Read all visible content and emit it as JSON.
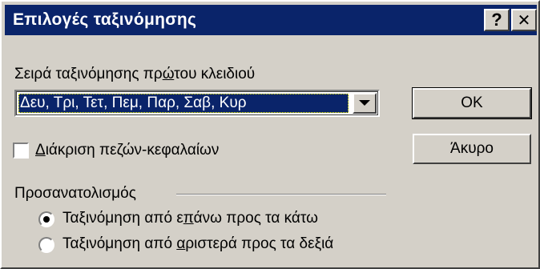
{
  "window": {
    "title": "Επιλογές ταξινόμησης",
    "help_label": "?",
    "close_label": "✕"
  },
  "first_key": {
    "label_before": "Σειρά ταξινόμησης πρ",
    "label_hotkey": "ώ",
    "label_after": "του κλειδιού",
    "selected_value": "Δευ, Τρι, Τετ, Πεμ, Παρ, Σαβ, Κυρ"
  },
  "case_sensitive": {
    "label_hotkey": "Δ",
    "label_after": "ιάκριση πεζών-κεφαλαίων",
    "checked": false
  },
  "orientation": {
    "label": "Προσανατολισμός",
    "options": [
      {
        "before": "Ταξινόμηση από ε",
        "hotkey": "π",
        "after": "άνω προς τα κάτω",
        "selected": true
      },
      {
        "before": "Ταξινόμηση από ",
        "hotkey": "α",
        "after": "ριστερά προς τα δεξιά",
        "selected": false
      }
    ]
  },
  "buttons": {
    "ok_label": "OK",
    "cancel_label": "Άκυρο"
  }
}
